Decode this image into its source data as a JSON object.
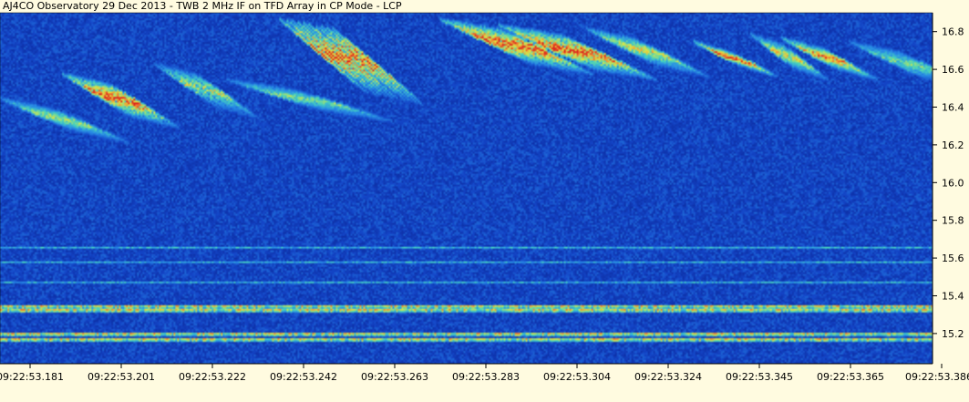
{
  "title": "AJ4CO Observatory 29 Dec 2013 - TWB 2 MHz IF on TFD Array in CP Mode - LCP",
  "colors": {
    "background": "#fffbe0",
    "noise_low": "#0a2a9c",
    "noise_high": "#1e5ad8",
    "burst_mid": "#4fd0c0",
    "burst_high": "#f0e040",
    "burst_peak": "#e84030"
  },
  "chart_data": {
    "type": "heatmap",
    "title": "AJ4CO Observatory 29 Dec 2013 - TWB 2 MHz IF on TFD Array in CP Mode - LCP",
    "xlabel": "",
    "ylabel": "",
    "x_tick_labels": [
      "09:22:53.181",
      "09:22:53.201",
      "09:22:53.222",
      "09:22:53.242",
      "09:22:53.263",
      "09:22:53.283",
      "09:22:53.304",
      "09:22:53.324",
      "09:22:53.345",
      "09:22:53.365",
      "09:22:53.386"
    ],
    "y_tick_labels": [
      "16.8",
      "16.6",
      "16.4",
      "16.2",
      "16.0",
      "15.8",
      "15.6",
      "15.4",
      "15.2"
    ],
    "y_ticks": [
      16.8,
      16.6,
      16.4,
      16.2,
      16.0,
      15.8,
      15.6,
      15.4,
      15.2
    ],
    "ylim": [
      15.04,
      16.9
    ],
    "x_range_s": [
      53.181,
      53.391
    ],
    "y_axis_side": "right",
    "interference_lines_mhz": [
      15.18,
      15.2,
      15.33,
      15.35,
      15.48,
      15.58,
      15.66
    ],
    "burst_groups": [
      {
        "x_start": 53.181,
        "x_end": 53.201,
        "f_top": 16.45,
        "f_bottom": 16.27,
        "intensity": 0.5
      },
      {
        "x_start": 53.195,
        "x_end": 53.213,
        "f_top": 16.58,
        "f_bottom": 16.35,
        "intensity": 0.85
      },
      {
        "x_start": 53.216,
        "x_end": 53.232,
        "f_top": 16.63,
        "f_bottom": 16.4,
        "intensity": 0.55
      },
      {
        "x_start": 53.232,
        "x_end": 53.258,
        "f_top": 16.55,
        "f_bottom": 16.38,
        "intensity": 0.45
      },
      {
        "x_start": 53.244,
        "x_end": 53.266,
        "f_top": 16.87,
        "f_bottom": 16.48,
        "intensity": 0.95
      },
      {
        "x_start": 53.28,
        "x_end": 53.304,
        "f_top": 16.87,
        "f_bottom": 16.63,
        "intensity": 0.9
      },
      {
        "x_start": 53.293,
        "x_end": 53.318,
        "f_top": 16.84,
        "f_bottom": 16.6,
        "intensity": 0.85
      },
      {
        "x_start": 53.313,
        "x_end": 53.332,
        "f_top": 16.82,
        "f_bottom": 16.62,
        "intensity": 0.6
      },
      {
        "x_start": 53.337,
        "x_end": 53.35,
        "f_top": 16.75,
        "f_bottom": 16.62,
        "intensity": 0.8
      },
      {
        "x_start": 53.35,
        "x_end": 53.362,
        "f_top": 16.79,
        "f_bottom": 16.6,
        "intensity": 0.6
      },
      {
        "x_start": 53.357,
        "x_end": 53.372,
        "f_top": 16.77,
        "f_bottom": 16.6,
        "intensity": 0.75
      },
      {
        "x_start": 53.372,
        "x_end": 53.392,
        "f_top": 16.75,
        "f_bottom": 16.55,
        "intensity": 0.45
      }
    ]
  }
}
